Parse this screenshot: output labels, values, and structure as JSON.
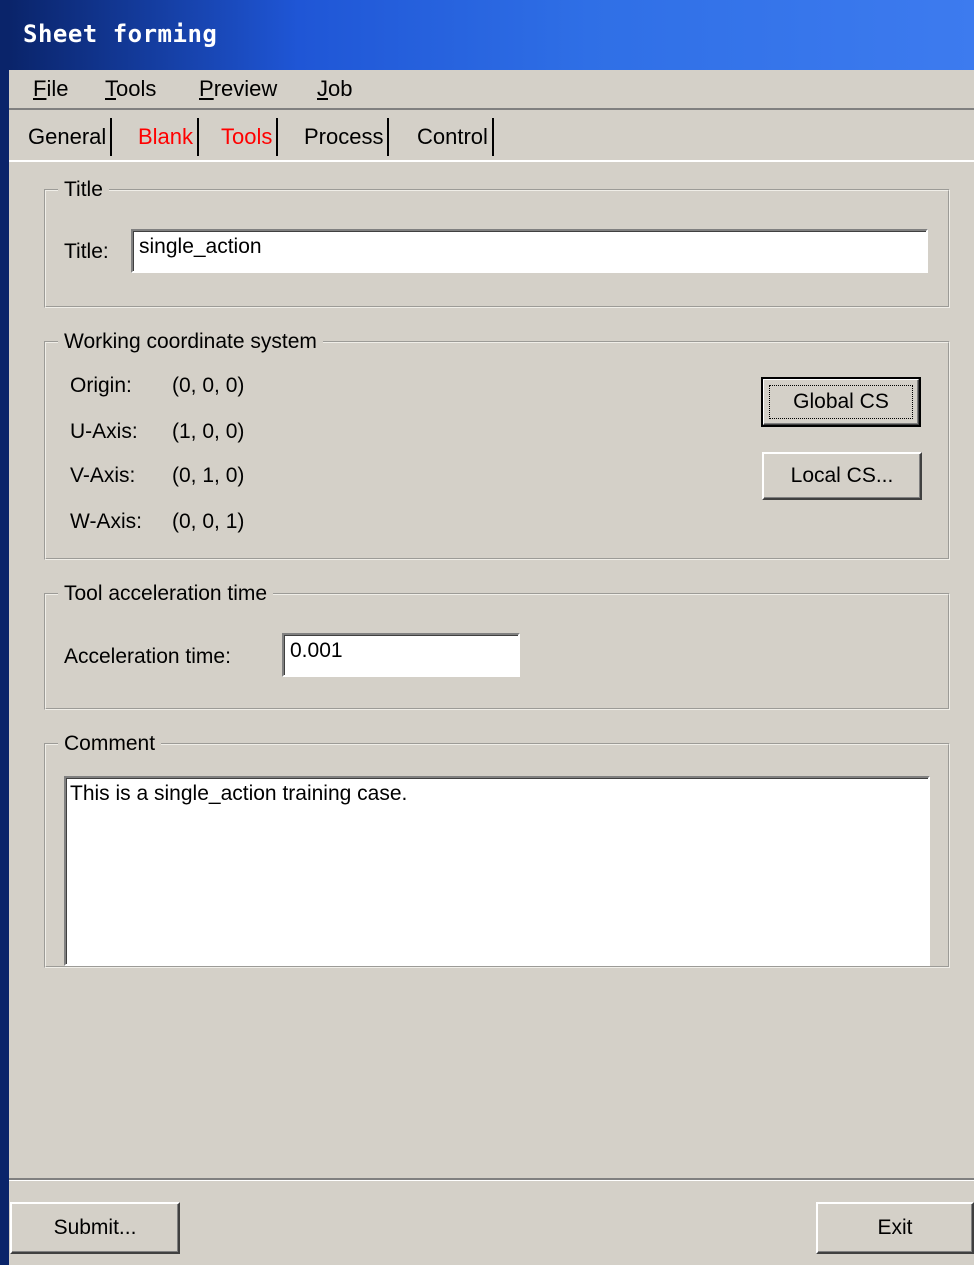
{
  "window": {
    "title": "Sheet forming"
  },
  "menu": [
    {
      "accel": "F",
      "rest": "ile"
    },
    {
      "accel": "T",
      "rest": "ools"
    },
    {
      "accel": "P",
      "rest": "review"
    },
    {
      "accel": "J",
      "rest": "ob"
    }
  ],
  "tabs": [
    {
      "label": "General",
      "color": "#000000",
      "active": true
    },
    {
      "label": "Blank",
      "color": "#ff0000"
    },
    {
      "label": "Tools",
      "color": "#ff0000"
    },
    {
      "label": "Process",
      "color": "#000000"
    },
    {
      "label": "Control",
      "color": "#000000"
    }
  ],
  "title_group": {
    "legend": "Title",
    "field_label": "Title:",
    "value": "single_action"
  },
  "wcs_group": {
    "legend": "Working coordinate system",
    "rows": [
      {
        "label": "Origin:",
        "value": "(0, 0, 0)"
      },
      {
        "label": "U-Axis:",
        "value": "(1, 0, 0)"
      },
      {
        "label": "V-Axis:",
        "value": "(0, 1, 0)"
      },
      {
        "label": "W-Axis:",
        "value": "(0, 0, 1)"
      }
    ],
    "global_button": "Global CS",
    "local_button": "Local CS..."
  },
  "accel_group": {
    "legend": "Tool acceleration time",
    "field_label": "Acceleration time:",
    "value": "0.001"
  },
  "comment_group": {
    "legend": "Comment",
    "value": "This is a single_action training case."
  },
  "footer": {
    "submit": "Submit...",
    "exit": "Exit"
  }
}
